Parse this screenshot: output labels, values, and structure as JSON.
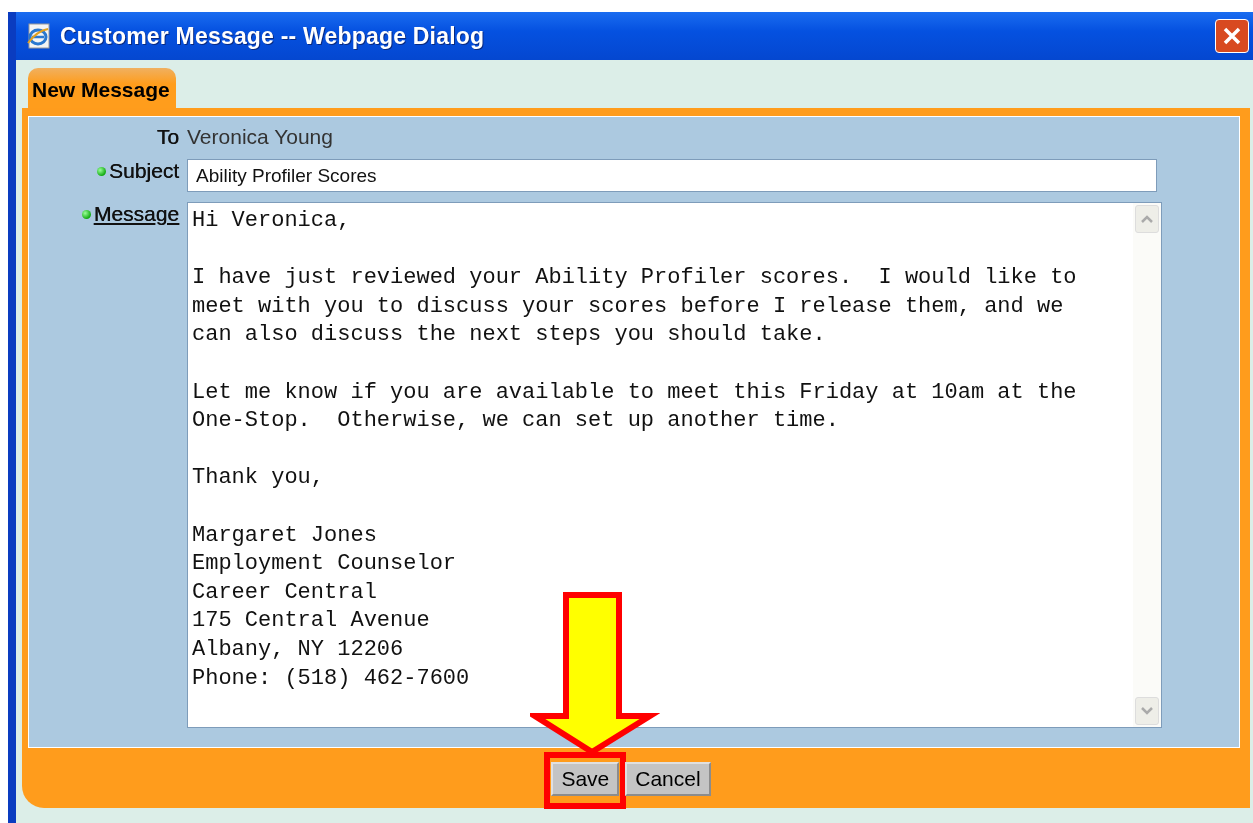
{
  "window": {
    "title": "Customer Message -- Webpage Dialog"
  },
  "tabs": [
    {
      "label": "New Message",
      "selected": true
    }
  ],
  "form": {
    "to": {
      "label": "To",
      "value": "Veronica Young"
    },
    "subject": {
      "label": "Subject",
      "required": true,
      "value": "Ability Profiler Scores"
    },
    "message": {
      "label": "Message",
      "required": true,
      "link": true,
      "value": "Hi Veronica,\n\nI have just reviewed your Ability Profiler scores.  I would like to\nmeet with you to discuss your scores before I release them, and we\ncan also discuss the next steps you should take.\n\nLet me know if you are available to meet this Friday at 10am at the\nOne-Stop.  Otherwise, we can set up another time.\n\nThank you,\n\nMargaret Jones\nEmployment Counselor\nCareer Central\n175 Central Avenue\nAlbany, NY 12206\nPhone: (518) 462-7600"
    }
  },
  "buttons": [
    {
      "label": "Save",
      "highlighted": true
    },
    {
      "label": "Cancel",
      "highlighted": false
    }
  ]
}
